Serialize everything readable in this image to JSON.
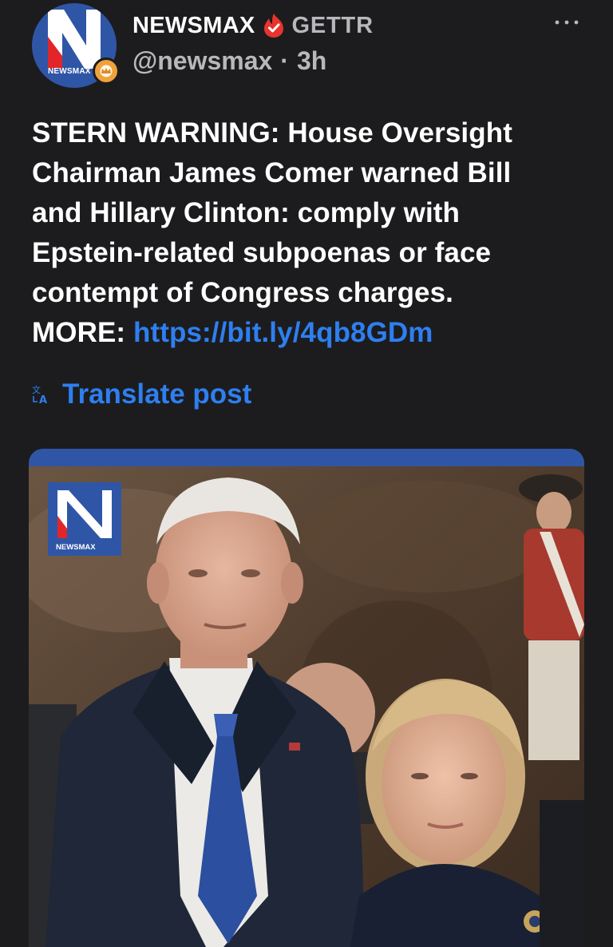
{
  "post": {
    "author": {
      "display_name": "NEWSMAX",
      "platform_brand": "GETTR",
      "handle": "@newsmax",
      "separator": "·",
      "time_ago": "3h",
      "avatar_text": "NEWSMAX"
    },
    "text_lines": [
      "STERN WARNING: House Oversight",
      "Chairman James Comer warned Bill",
      "and Hillary Clinton: comply with",
      "Epstein-related subpoenas or face",
      "contempt of Congress charges."
    ],
    "more_label": "MORE: ",
    "link": "https://bit.ly/4qb8GDm",
    "translate_label": "Translate post",
    "media": {
      "watermark_text": "NEWSMAX"
    }
  },
  "colors": {
    "background": "#1c1c1e",
    "link": "#2e7ff0",
    "muted": "#b8b8bc",
    "newsmax_blue": "#2f56a6",
    "gettr_red": "#e8342c"
  },
  "icons": {
    "avatar": "newsmax-logo",
    "badge": "crown-badge-icon",
    "brand": "gettr-flame-icon",
    "more": "more-dots-icon",
    "translate": "translate-icon"
  }
}
